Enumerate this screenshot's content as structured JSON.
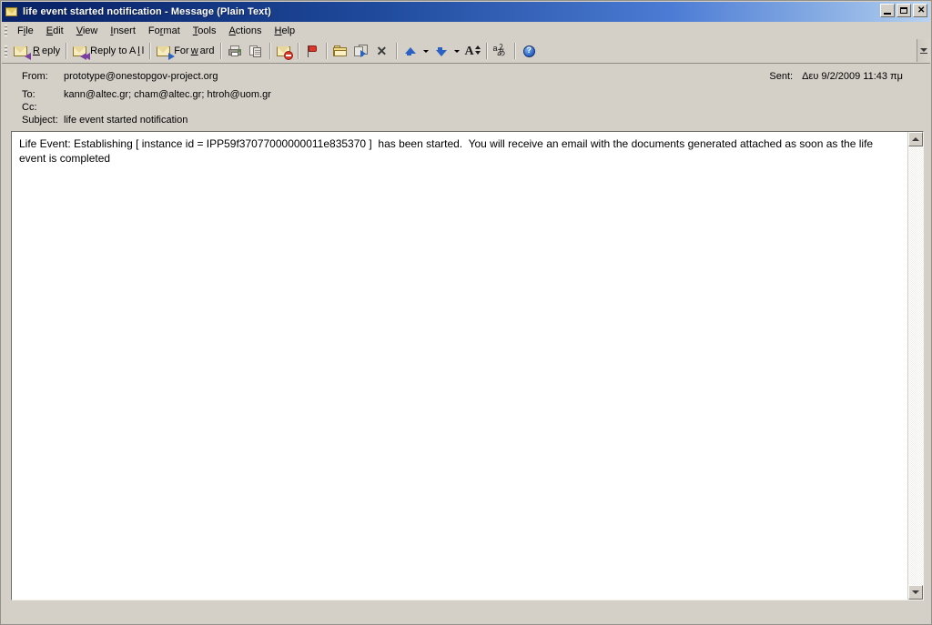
{
  "window": {
    "title": "life event started notification - Message (Plain Text)",
    "icon": "envelope-icon",
    "minimize_label": "",
    "maximize_label": "",
    "close_label": "✕"
  },
  "menubar": {
    "items": [
      {
        "name": "file",
        "pre": "F",
        "accel": "i",
        "post": "le"
      },
      {
        "name": "edit",
        "pre": "",
        "accel": "E",
        "post": "dit"
      },
      {
        "name": "view",
        "pre": "",
        "accel": "V",
        "post": "iew"
      },
      {
        "name": "insert",
        "pre": "",
        "accel": "I",
        "post": "nsert"
      },
      {
        "name": "format",
        "pre": "Fo",
        "accel": "r",
        "post": "mat"
      },
      {
        "name": "tools",
        "pre": "",
        "accel": "T",
        "post": "ools"
      },
      {
        "name": "actions",
        "pre": "",
        "accel": "A",
        "post": "ctions"
      },
      {
        "name": "help",
        "pre": "",
        "accel": "H",
        "post": "elp"
      }
    ]
  },
  "toolbar": {
    "reply": {
      "pre": "",
      "accel": "R",
      "post": "eply",
      "icon": "reply-envelope-icon"
    },
    "reply_all": {
      "pre": "Reply to A",
      "accel": "l",
      "post": "l",
      "icon": "reply-all-envelope-icon"
    },
    "forward": {
      "pre": "For",
      "accel": "w",
      "post": "ard",
      "icon": "forward-envelope-icon"
    },
    "print": {
      "label": "",
      "icon": "printer-icon"
    },
    "copy": {
      "label": "",
      "icon": "copy-pages-icon"
    },
    "block_sender": {
      "label": "",
      "icon": "block-sender-envelope-icon"
    },
    "follow_up": {
      "label": "",
      "icon": "red-flag-icon"
    },
    "move_to_folder": {
      "label": "",
      "icon": "folder-icon"
    },
    "copy_to_folder": {
      "label": "",
      "icon": "copy-to-folder-icon"
    },
    "delete": {
      "label": "✕",
      "icon": "delete-x-icon"
    },
    "previous_item": {
      "label": "",
      "icon": "blue-up-arrow-icon"
    },
    "next_item": {
      "label": "",
      "icon": "blue-down-arrow-icon"
    },
    "font_size": {
      "label": "A",
      "icon": "font-size-icon"
    },
    "phonetic_guide": {
      "label_a": "a",
      "label_kana": "あ",
      "label_mark": "ʔ",
      "icon": "phonetic-guide-icon"
    },
    "help": {
      "label": "",
      "icon": "help-question-icon"
    },
    "overflow": {
      "label": "",
      "icon": "toolbar-overflow-icon"
    }
  },
  "message": {
    "from_label": "From:",
    "from_value": "prototype@onestopgov-project.org",
    "to_label": "To:",
    "to_value": "kann@altec.gr; cham@altec.gr; htroh@uom.gr",
    "cc_label": "Cc:",
    "cc_value": "",
    "subject_label": "Subject:",
    "subject_value": "life event started notification",
    "sent_label": "Sent:",
    "sent_value": "Δευ 9/2/2009 11:43 πμ",
    "body": "Life Event: Establishing [ instance id = IPP59f37077000000011e835370 ]  has been started.  You will receive an email with the documents generated attached as soon as the life event is completed"
  },
  "scrollbar": {
    "up_label": "",
    "down_label": ""
  },
  "colors": {
    "titlebar_start": "#0a246a",
    "titlebar_end": "#b9d3f2",
    "window_face": "#d4d0c8",
    "body_background": "#ffffff",
    "accent_blue": "#2a62c4",
    "flag_red": "#d8392b"
  }
}
